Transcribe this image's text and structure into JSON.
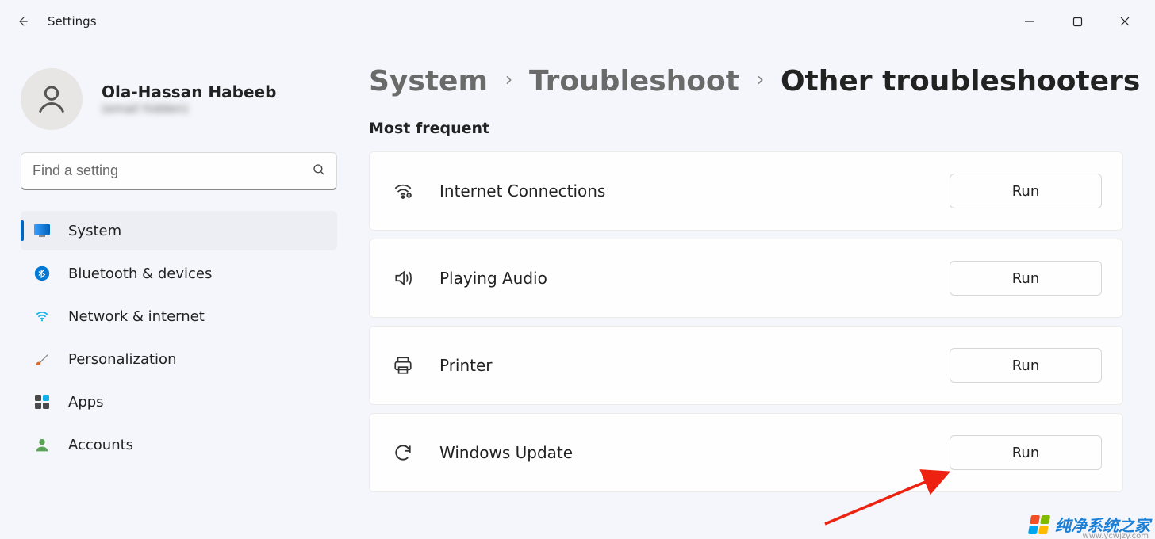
{
  "titlebar": {
    "app_title": "Settings"
  },
  "profile": {
    "name": "Ola-Hassan Habeeb",
    "email": "(email hidden)"
  },
  "search": {
    "placeholder": "Find a setting"
  },
  "sidebar": {
    "items": [
      {
        "label": "System",
        "icon": "monitor-icon",
        "active": true
      },
      {
        "label": "Bluetooth & devices",
        "icon": "bluetooth-icon",
        "active": false
      },
      {
        "label": "Network & internet",
        "icon": "wifi-icon",
        "active": false
      },
      {
        "label": "Personalization",
        "icon": "brush-icon",
        "active": false
      },
      {
        "label": "Apps",
        "icon": "apps-icon",
        "active": false
      },
      {
        "label": "Accounts",
        "icon": "person-icon",
        "active": false
      }
    ]
  },
  "breadcrumb": {
    "crumb1": "System",
    "crumb2": "Troubleshoot",
    "current": "Other troubleshooters"
  },
  "main": {
    "section_title": "Most frequent",
    "run_label": "Run",
    "troubleshooters": [
      {
        "label": "Internet Connections",
        "icon": "wifi-diag-icon"
      },
      {
        "label": "Playing Audio",
        "icon": "speaker-icon"
      },
      {
        "label": "Printer",
        "icon": "printer-icon"
      },
      {
        "label": "Windows Update",
        "icon": "update-icon"
      }
    ]
  },
  "watermark": {
    "text": "纯净系统之家",
    "url": "www.ycwjzy.com"
  }
}
